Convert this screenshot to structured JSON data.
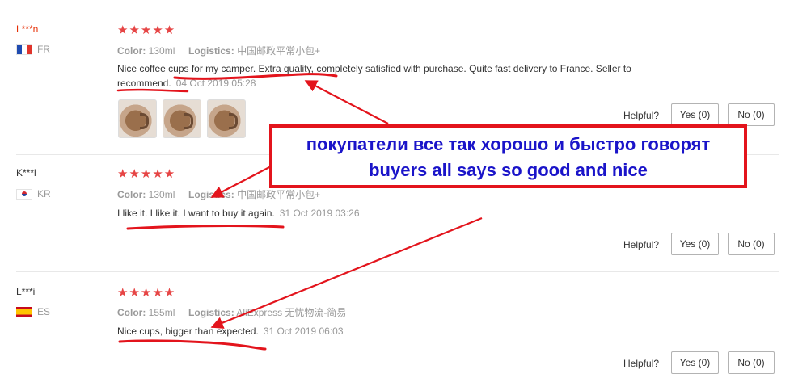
{
  "reviews": [
    {
      "user": "L***n",
      "country": "FR",
      "stars": "★★★★★",
      "color_label": "Color:",
      "color_value": "130ml",
      "logistics_label": "Logistics:",
      "logistics_value": "中国邮政平常小包+",
      "text": "Nice coffee cups for my camper. Extra quality, completely satisfied with purchase. Quite fast delivery to France. Seller to recommend.",
      "date": "04 Oct 2019 05:28",
      "photos": [
        "cup-photo-1",
        "cup-photo-2",
        "cup-photo-3"
      ],
      "helpful_label": "Helpful?",
      "yes_label": "Yes (0)",
      "no_label": "No (0)"
    },
    {
      "user": "K***l",
      "country": "KR",
      "stars": "★★★★★",
      "color_label": "Color:",
      "color_value": "130ml",
      "logistics_label": "Logistics:",
      "logistics_value": "中国邮政平常小包+",
      "text": "I like it. I like it. I want to buy it again.",
      "date": "31 Oct 2019 03:26",
      "helpful_label": "Helpful?",
      "yes_label": "Yes (0)",
      "no_label": "No (0)"
    },
    {
      "user": "L***i",
      "country": "ES",
      "stars": "★★★★★",
      "color_label": "Color:",
      "color_value": "155ml",
      "logistics_label": "Logistics:",
      "logistics_value": "AliExpress 无忧物流-简易",
      "text": "Nice cups, bigger than expected.",
      "date": "31 Oct 2019 06:03",
      "helpful_label": "Helpful?",
      "yes_label": "Yes (0)",
      "no_label": "No (0)"
    }
  ],
  "callout": {
    "line1": "покупатели все так хорошо и быстро говорят",
    "line2": "buyers all says so good and nice"
  },
  "colors": {
    "stars": "#e64545",
    "annotation_red": "#e3141c",
    "callout_text": "#1a14c9"
  },
  "icons": {
    "star": "star-icon",
    "flag_fr": "flag-fr-icon",
    "flag_kr": "flag-kr-icon",
    "flag_es": "flag-es-icon"
  }
}
